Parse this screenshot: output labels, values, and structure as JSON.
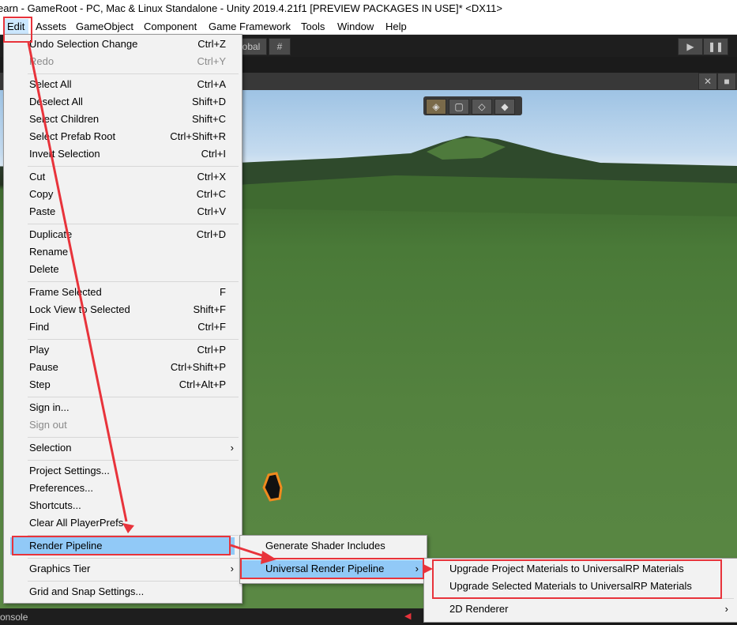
{
  "window_title": "earn - GameRoot - PC, Mac & Linux Standalone - Unity 2019.4.21f1 [PREVIEW PACKAGES IN USE]* <DX11>",
  "menubar": [
    "Edit",
    "Assets",
    "GameObject",
    "Component",
    "Game Framework",
    "Tools",
    "Window",
    "Help"
  ],
  "toolbar": {
    "global_label": "obal"
  },
  "bottom": {
    "console_label": "onsole"
  },
  "edit_menu": [
    {
      "label": "Undo Selection Change",
      "shortcut": "Ctrl+Z"
    },
    {
      "label": "Redo",
      "shortcut": "Ctrl+Y",
      "disabled": true
    },
    {
      "label": "Select All",
      "shortcut": "Ctrl+A"
    },
    {
      "label": "Deselect All",
      "shortcut": "Shift+D"
    },
    {
      "label": "Select Children",
      "shortcut": "Shift+C"
    },
    {
      "label": "Select Prefab Root",
      "shortcut": "Ctrl+Shift+R"
    },
    {
      "label": "Invert Selection",
      "shortcut": "Ctrl+I"
    },
    {
      "label": "Cut",
      "shortcut": "Ctrl+X"
    },
    {
      "label": "Copy",
      "shortcut": "Ctrl+C"
    },
    {
      "label": "Paste",
      "shortcut": "Ctrl+V"
    },
    {
      "label": "Duplicate",
      "shortcut": "Ctrl+D"
    },
    {
      "label": "Rename",
      "shortcut": ""
    },
    {
      "label": "Delete",
      "shortcut": ""
    },
    {
      "label": "Frame Selected",
      "shortcut": "F"
    },
    {
      "label": "Lock View to Selected",
      "shortcut": "Shift+F"
    },
    {
      "label": "Find",
      "shortcut": "Ctrl+F"
    },
    {
      "label": "Play",
      "shortcut": "Ctrl+P"
    },
    {
      "label": "Pause",
      "shortcut": "Ctrl+Shift+P"
    },
    {
      "label": "Step",
      "shortcut": "Ctrl+Alt+P"
    },
    {
      "label": "Sign in...",
      "shortcut": ""
    },
    {
      "label": "Sign out",
      "shortcut": "",
      "disabled": true
    },
    {
      "label": "Selection",
      "shortcut": "",
      "submenu": true
    },
    {
      "label": "Project Settings...",
      "shortcut": ""
    },
    {
      "label": "Preferences...",
      "shortcut": ""
    },
    {
      "label": "Shortcuts...",
      "shortcut": ""
    },
    {
      "label": "Clear All PlayerPrefs",
      "shortcut": ""
    },
    {
      "label": "Render Pipeline",
      "shortcut": "",
      "highlighted": true
    },
    {
      "label": "Graphics Tier",
      "shortcut": "",
      "submenu": true
    },
    {
      "label": "Grid and Snap Settings...",
      "shortcut": ""
    }
  ],
  "render_pipeline_menu": [
    {
      "label": "Generate Shader Includes"
    },
    {
      "label": "Universal Render Pipeline",
      "submenu": true,
      "highlighted": true
    }
  ],
  "urp_menu": [
    {
      "label": "Upgrade Project Materials to UniversalRP Materials"
    },
    {
      "label": "Upgrade Selected Materials to UniversalRP Materials"
    },
    {
      "label": "2D Renderer",
      "submenu": true
    }
  ],
  "colors": {
    "annotation_red": "#e8333b",
    "highlight": "#91c9f7",
    "menubar_active": "#cce8ff"
  }
}
